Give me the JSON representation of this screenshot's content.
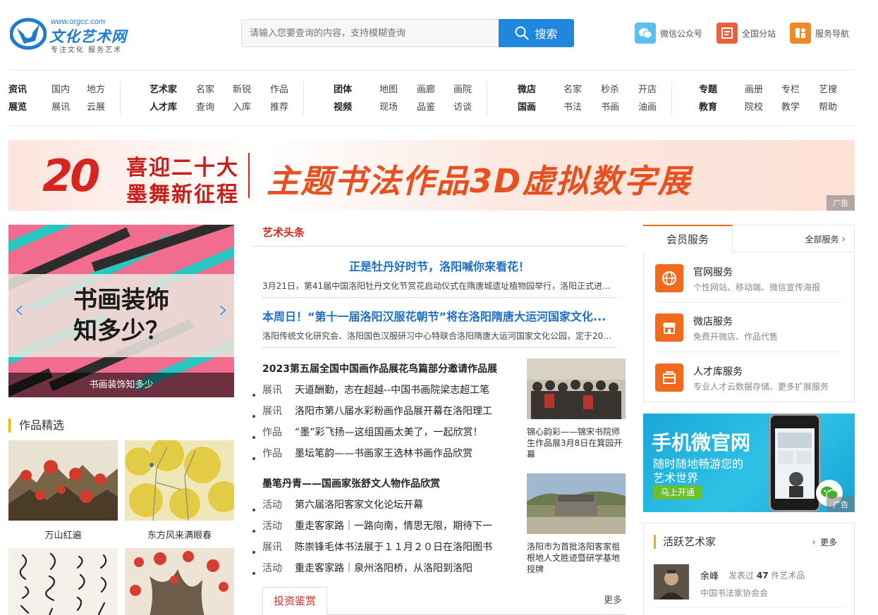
{
  "logo": {
    "url": "www.orgcc.com",
    "name": "文化艺术网",
    "slogan": "专注文化   服务艺术"
  },
  "search": {
    "placeholder": "请输入您要查询的内容，支持模糊查询",
    "button": "搜索"
  },
  "top_links": [
    {
      "label": "微信公众号",
      "icon": "wechat-icon",
      "color": "#5bc0f0"
    },
    {
      "label": "全国分站",
      "icon": "branch-icon",
      "color": "#e9603a"
    },
    {
      "label": "服务导航",
      "icon": "nav-icon",
      "color": "#f08a26"
    }
  ],
  "nav": [
    {
      "rows": [
        [
          "资讯",
          "国内",
          "地方"
        ],
        [
          "展览",
          "展讯",
          "云展"
        ]
      ]
    },
    {
      "rows": [
        [
          "艺术家",
          "名家",
          "新锐",
          "作品"
        ],
        [
          "人才库",
          "查询",
          "入库",
          "推荐"
        ]
      ]
    },
    {
      "rows": [
        [
          "团体",
          "地图",
          "画廊",
          "画院"
        ],
        [
          "视频",
          "现场",
          "品鉴",
          "访谈"
        ]
      ]
    },
    {
      "rows": [
        [
          "微店",
          "名家",
          "秒杀",
          "开店"
        ],
        [
          "国画",
          "书法",
          "书画",
          "油画"
        ]
      ]
    },
    {
      "rows": [
        [
          "专题",
          "画册",
          "专栏",
          "艺搜"
        ],
        [
          "教育",
          "院校",
          "教学",
          "帮助"
        ]
      ]
    }
  ],
  "banner": {
    "num": "20",
    "line1": "喜迎二十大",
    "line2": "墨舞新征程",
    "main": "主题书法作品3D虚拟数字展",
    "ad": "广告"
  },
  "slider": {
    "title_l1": "书画装饰",
    "title_l2": "知多少？",
    "caption": "书画装饰知多少",
    "prev": "‹",
    "next": "›"
  },
  "works": {
    "title": "作品精选",
    "items": [
      {
        "caption": "万山红遍"
      },
      {
        "caption": "东方风来满眼春"
      },
      {
        "caption": ""
      },
      {
        "caption": ""
      }
    ]
  },
  "headlines": {
    "tab": "艺术头条",
    "items": [
      {
        "title": "正是牡丹好时节，洛阳喊你来看花！",
        "desc": "3月21日，第41届中国洛阳牡丹文化节赏花启动仪式在隋唐城遗址植物园举行，洛阳正式进..."
      },
      {
        "title": "本周日！“第十一届洛阳汉服花朝节”将在洛阳隋唐大运河国家文化...",
        "desc": "洛阳传统文化研究会、洛阳国色汉服研习中心特联合洛阳隋唐大运河国家文化公园，定于202..."
      }
    ]
  },
  "news_group1": {
    "head": "2023第五届全国中国画作品展花鸟篇部分邀请作品展",
    "items": [
      {
        "cat": "展讯",
        "text": "天道酬勤，志在超越--中国书画院梁志超工笔"
      },
      {
        "cat": "展讯",
        "text": "洛阳市第八届水彩粉画作品展开幕在洛阳理工"
      },
      {
        "cat": "作品",
        "text": "“墨”彩飞扬—这组国画太美了，一起欣赏！"
      },
      {
        "cat": "作品",
        "text": "墨坛笔韵——书画家王选林书画作品欣赏"
      }
    ],
    "thumb_caption": "锦心韵彩——锦宋书院师生作品展3月8日在箕园开幕"
  },
  "news_group2": {
    "head": "墨笔丹青——国画家张舒文人物作品欣赏",
    "items": [
      {
        "cat": "活动",
        "text": "第六届洛阳客家文化论坛开幕"
      },
      {
        "cat": "活动",
        "text": "重走客家路｜一路向南，情思无限，期待下一"
      },
      {
        "cat": "展讯",
        "text": "陈崇锋毛体书法展于１１月２０日在洛阳图书"
      },
      {
        "cat": "活动",
        "text": "重走客家路｜泉州洛阳桥，从洛阳到洛阳"
      }
    ],
    "thumb_caption": "洛阳市为首批洛阳客家祖根地人文胜迹暨研学基地授牌"
  },
  "invest": {
    "tab": "投资鉴赏",
    "more": "更多"
  },
  "member": {
    "tab": "会员服务",
    "all": "全部服务",
    "services": [
      {
        "name": "官网服务",
        "desc": "个性网站、移动端、微信宣传海报",
        "icon": "globe-icon"
      },
      {
        "name": "微店服务",
        "desc": "免费开微店、作品代售",
        "icon": "shop-icon"
      },
      {
        "name": "人才库服务",
        "desc": "专业人才云数据存储、更多扩展服务",
        "icon": "database-icon"
      }
    ]
  },
  "mobile_ad": {
    "title": "手机微官网",
    "sub1": "随时随地畅游您的",
    "sub2": "艺术世界",
    "button": "马上开通",
    "ad": "广告"
  },
  "active_artists": {
    "title": "活跃艺术家",
    "more": "更多",
    "items": [
      {
        "name": "余峰",
        "stat_prefix": "发表过",
        "count": "47",
        "stat_suffix": "件艺术品",
        "org": "中国书法家协会会"
      }
    ]
  },
  "colors": {
    "accent_blue": "#2186de",
    "accent_orange": "#f36a1c",
    "headline_red": "#d0281f",
    "title_blue": "#1f6fc4"
  }
}
